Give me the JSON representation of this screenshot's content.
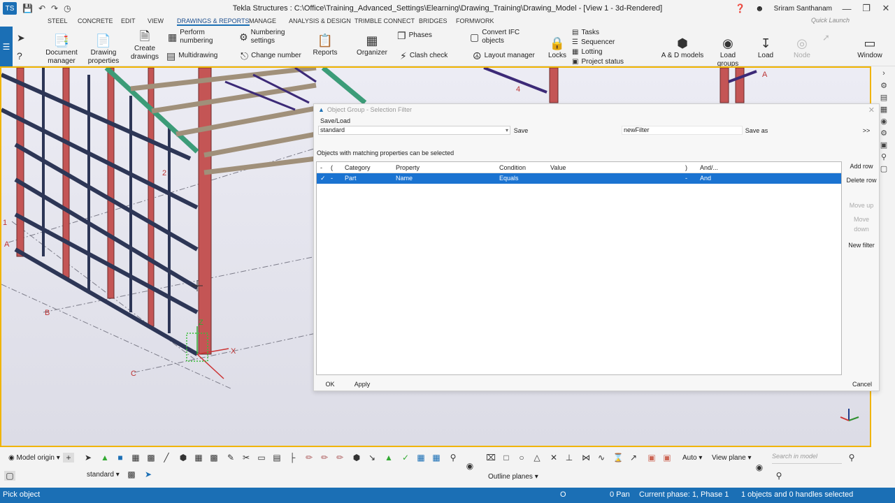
{
  "window": {
    "title": "Tekla Structures : C:\\Office\\Training_Advanced_Settings\\Elearning\\Drawing_Training\\Drawing_Model - [View 1 - 3d-Rendered]",
    "user": "Sriram Santhanam",
    "quick_launch_placeholder": "Quick Launch"
  },
  "menu_tabs": [
    "STEEL",
    "CONCRETE",
    "EDIT",
    "VIEW",
    "DRAWINGS & REPORTS",
    "MANAGE",
    "ANALYSIS & DESIGN",
    "TRIMBLE CONNECT",
    "BRIDGES",
    "FORMWORK"
  ],
  "active_tab": "DRAWINGS & REPORTS",
  "ribbon": {
    "document_manager": "Document manager",
    "drawing_properties": "Drawing properties",
    "create_drawings": "Create drawings",
    "perform_numbering": "Perform numbering",
    "multidrawing": "Multidrawing",
    "numbering_settings": "Numbering settings",
    "change_number": "Change number",
    "reports": "Reports",
    "organizer": "Organizer",
    "phases": "Phases",
    "clash_check": "Clash check",
    "convert_ifc": "Convert IFC objects",
    "layout_manager": "Layout manager",
    "locks": "Locks",
    "tasks": "Tasks",
    "sequencer": "Sequencer",
    "lotting": "Lotting",
    "project_status": "Project status",
    "ad_models": "A & D models",
    "load_groups": "Load groups",
    "load": "Load",
    "node": "Node",
    "window": "Window"
  },
  "viewport_labels": {
    "grid_a_left": "A",
    "grid_b": "B",
    "grid_c": "C",
    "grid_2": "2",
    "grid_4": "4",
    "grid_1": "1",
    "grid_a_right": "A",
    "axis_x": "X",
    "axis_z": "Z"
  },
  "dialog": {
    "title": "Object Group - Selection Filter",
    "save_load_label": "Save/Load",
    "save_load_value": "standard",
    "save_button": "Save",
    "save_as_value": "newFilter",
    "save_as_button": "Save as",
    "expand_button": ">>",
    "description": "Objects with matching properties can be selected",
    "columns": [
      "-",
      "(",
      "Category",
      "Property",
      "Condition",
      "Value",
      ")",
      "And/..."
    ],
    "row": {
      "check": "✓",
      "open": "-",
      "category": "Part",
      "property": "Name",
      "condition": "Equals",
      "value": "",
      "close": "-",
      "and_or": "And"
    },
    "add_row": "Add row",
    "delete_row": "Delete row",
    "move_up": "Move up",
    "move_down": "Move down",
    "new_filter": "New filter",
    "ok": "OK",
    "apply": "Apply",
    "cancel": "Cancel"
  },
  "bottom": {
    "model_origin": "Model origin",
    "standard": "standard",
    "auto": "Auto",
    "view_plane": "View plane",
    "outline_planes": "Outline planes",
    "search_placeholder": "Search in model"
  },
  "status": {
    "message": "Pick object",
    "o_indicator": "O",
    "pan": "0 Pan",
    "phase": "Current phase: 1, Phase 1",
    "selection": "1 objects and 0 handles selected"
  },
  "colors": {
    "accent": "#1b6fb5",
    "selection": "#1a73d1",
    "viewport_border": "#f0b400"
  }
}
